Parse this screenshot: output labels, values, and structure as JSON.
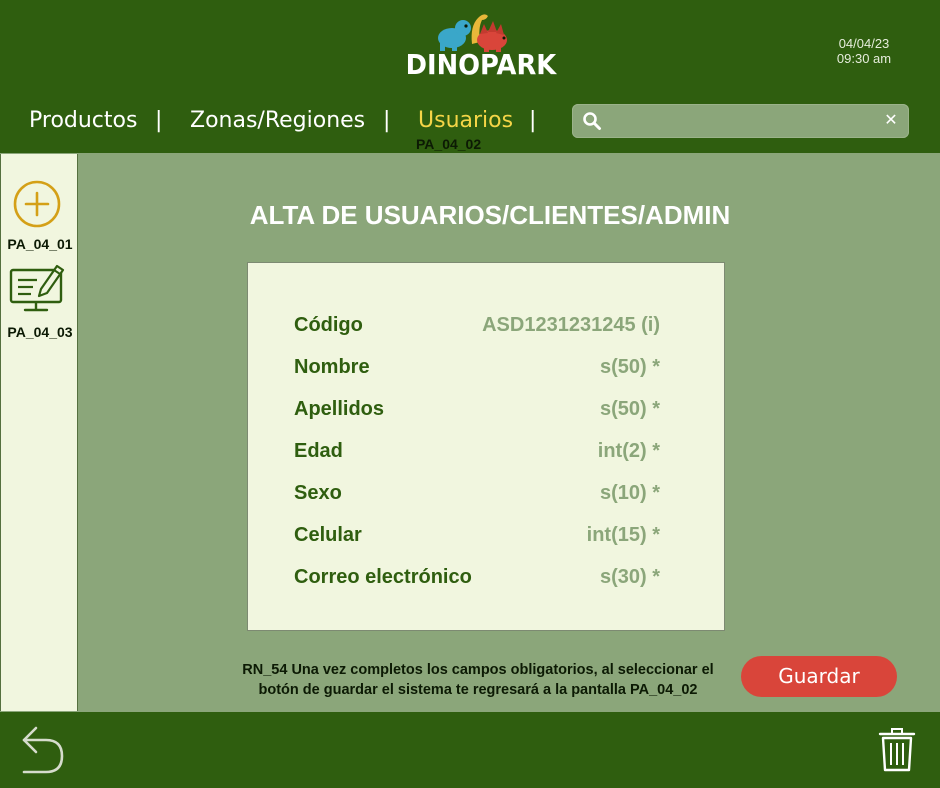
{
  "header": {
    "logo_text": "DINOPARK",
    "date": "04/04/23",
    "time": "09:30 am",
    "nav": {
      "items": [
        {
          "label": "Productos"
        },
        {
          "label": "Zonas/Regiones"
        },
        {
          "label": "Usuarios"
        }
      ],
      "separator": "|",
      "active_code": "PA_04_02"
    },
    "search": {
      "placeholder": "",
      "value": "",
      "clear": "✕"
    }
  },
  "sidebar": {
    "items": [
      {
        "label": "PA_04_01",
        "icon": "add-circle-icon"
      },
      {
        "label": "PA_04_03",
        "icon": "edit-monitor-icon"
      }
    ]
  },
  "main": {
    "title": "ALTA DE USUARIOS/CLIENTES/ADMIN",
    "fields": [
      {
        "label": "Código",
        "value": "ASD1231231245 (i)"
      },
      {
        "label": "Nombre",
        "value": "s(50) *"
      },
      {
        "label": "Apellidos",
        "value": "s(50) *"
      },
      {
        "label": "Edad",
        "value": "int(2) *"
      },
      {
        "label": "Sexo",
        "value": "s(10) *"
      },
      {
        "label": "Celular",
        "value": "int(15) *"
      },
      {
        "label": "Correo electrónico",
        "value": "s(30) *"
      }
    ],
    "rule_line1": "RN_54 Una vez completos los campos obligatorios, al seleccionar el",
    "rule_line2": "botón de guardar el sistema te regresará a la pantalla PA_04_02",
    "save_label": "Guardar"
  },
  "colors": {
    "header_bg": "#2f5e0f",
    "body_bg": "#8ba67a",
    "panel_bg": "#f1f6df",
    "accent_yellow": "#f5d547",
    "save_button": "#d9453a",
    "label_green": "#2f5e0f",
    "value_gray_green": "#8ba67a"
  }
}
